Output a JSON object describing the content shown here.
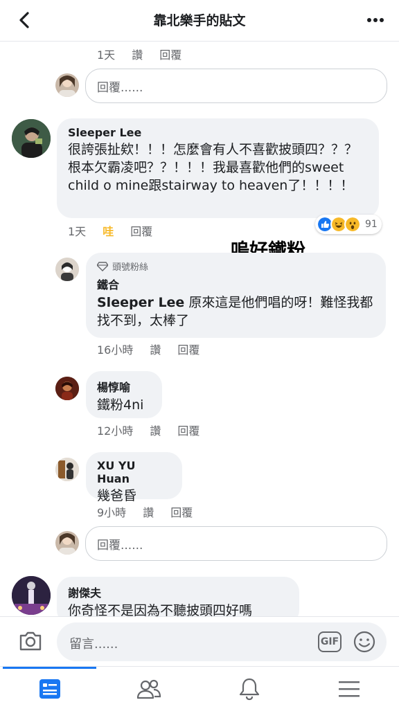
{
  "header": {
    "title": "靠北樂手的貼文"
  },
  "actions": {
    "like": "讚",
    "reply": "回覆",
    "like_reacted": "哇"
  },
  "reply_placeholder": "回覆......",
  "top_thread": {
    "time": "1天"
  },
  "comment_main": {
    "author": "Sleeper Lee",
    "text": "很誇張扯欸！！！怎麼會有人不喜歡披頭四？？？根本欠霸凌吧？？！！！我最喜歡他們的sweet child o mine跟stairway to heaven了！！！！",
    "time": "1天",
    "reaction_count": "91"
  },
  "overlay_caption": "嗚好鐵粉",
  "reply_1": {
    "badge": "頭號粉絲",
    "author": "鐵合",
    "mention": "Sleeper Lee",
    "text": " 原來這是他們唱的呀！難怪我都找不到，太棒了",
    "time": "16小時"
  },
  "reply_2": {
    "author": "楊惇喻",
    "text": "鐵粉4ni",
    "time": "12小時"
  },
  "reply_3": {
    "author": "XU YU Huan",
    "text": "幾爸昏",
    "time": "9小時"
  },
  "comment_last": {
    "author": "謝傑夫",
    "text": "你奇怪不是因為不聽披頭四好嗎"
  },
  "composer": {
    "placeholder": "留言......",
    "gif_label": "GIF"
  },
  "colors": {
    "accent": "#1877f2",
    "reaction_wow": "#f7b928"
  },
  "icons": {
    "back": "chevron-left-icon",
    "more": "more-dots-icon",
    "camera": "camera-icon",
    "emoji": "smiley-icon",
    "feed": "news-feed-icon",
    "friends": "friends-icon",
    "notifications": "bell-icon",
    "menu": "hamburger-menu-icon"
  }
}
